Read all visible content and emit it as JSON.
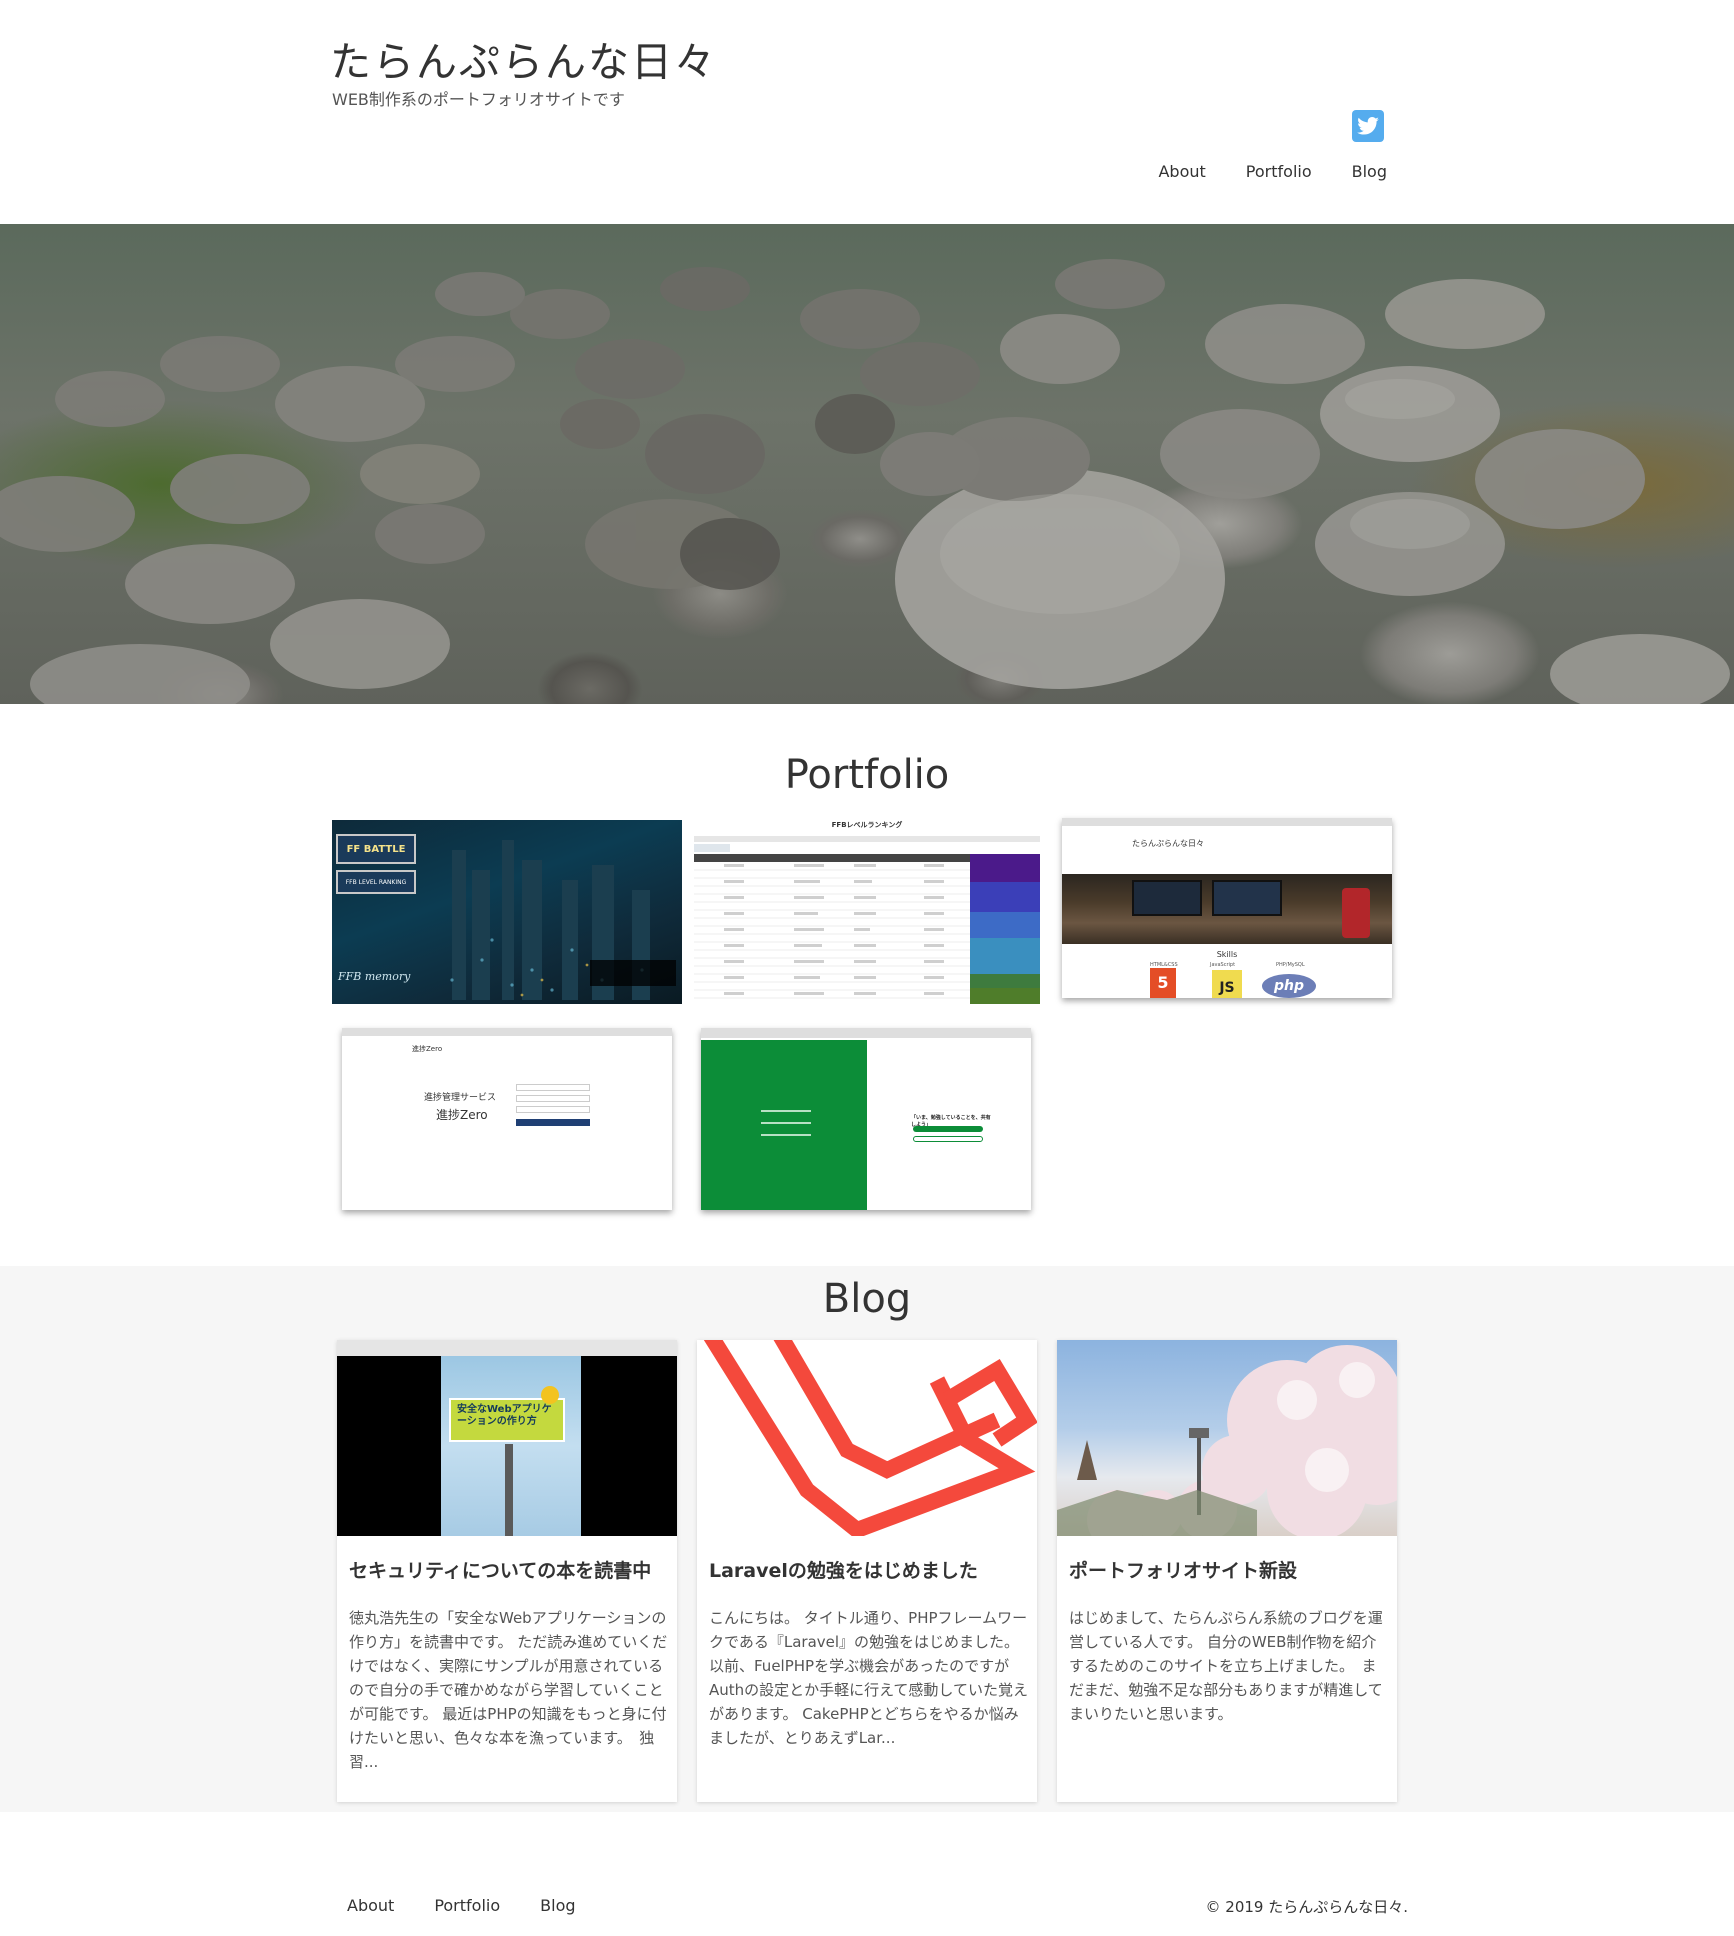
{
  "header": {
    "site_title": "たらんぷらんな日々",
    "subtitle": "WEB制作系のポートフォリオサイトです",
    "social_icon": "twitter-icon",
    "nav": [
      {
        "label": "About"
      },
      {
        "label": "Portfolio"
      },
      {
        "label": "Blog"
      }
    ]
  },
  "portfolio": {
    "title": "Portfolio",
    "items": [
      {
        "name": "ff-battle",
        "brand_text": "FF BATTLE",
        "sub_text": "FFB LEVEL RANKING",
        "script_text": "FFB memory"
      },
      {
        "name": "ffb-level-ranking",
        "heading": "FFBレベルランキング"
      },
      {
        "name": "taranpuran-portfolio",
        "site_title": "たらんぷらんな日々",
        "skills_label": "Skills",
        "html_label": "HTML&CSS",
        "js_label": "JavaScript",
        "php_label": "PHP/MySQL",
        "php_logo": "php",
        "js_logo": "JS"
      },
      {
        "name": "shinchoku-zero",
        "brand": "進捗Zero",
        "service_label": "進捗管理サービス",
        "service_name": "進捗Zero"
      },
      {
        "name": "green-login-app",
        "headline": "「いま、勉強していることを、共有しよう」"
      }
    ]
  },
  "blog": {
    "title": "Blog",
    "posts": [
      {
        "title": "セキュリティについての本を読書中",
        "excerpt": "徳丸浩先生の「安全なWebアプリケーションの作り方」を読書中です。 ただ読み進めていくだけではなく、実際にサンプルが用意されているので自分の手で確かめながら学習していくことが可能です。 最近はPHPの知識をもっと身に付けたいと思い、色々な本を漁っています。　独習...",
        "thumb_text": "安全なWebアプリケーションの作り方"
      },
      {
        "title": "Laravelの勉強をはじめました",
        "excerpt": "こんにちは。 タイトル通り、PHPフレームワークである『Laravel』の勉強をはじめました。　以前、FuelPHPを学ぶ機会があったのですがAuthの設定とか手軽に行えて感動していた覚えがあります。 CakePHPとどちらをやるか悩みましたが、とりあえずLar..."
      },
      {
        "title": "ポートフォリオサイト新設",
        "excerpt": "はじめまして、たらんぷらん系統のブログを運営している人です。 自分のWEB制作物を紹介するためのこのサイトを立ち上げました。　まだまだ、勉強不足な部分もありますが精進してまいりたいと思います。"
      }
    ]
  },
  "footer": {
    "nav": [
      {
        "label": "About"
      },
      {
        "label": "Portfolio"
      },
      {
        "label": "Blog"
      }
    ],
    "copyright": "© 2019 たらんぷらんな日々."
  },
  "colors": {
    "twitter": "#55acee",
    "laravel_red": "#f4493c",
    "green_app": "#0c8d38",
    "text": "#333333"
  }
}
